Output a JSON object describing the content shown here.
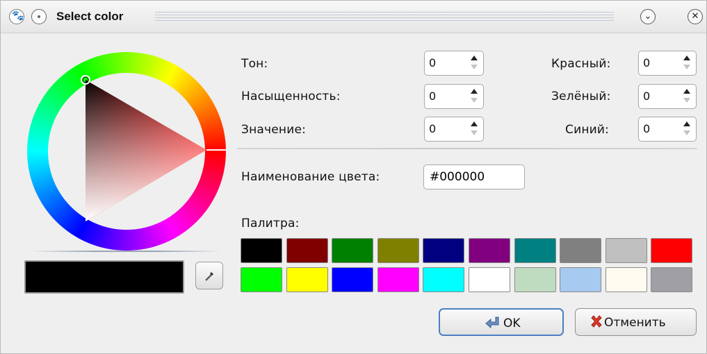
{
  "window": {
    "title": "Select color",
    "icons": [
      "paw-icon",
      "sticky-dot-icon",
      "minimize-chevron-icon",
      "close-x-icon"
    ]
  },
  "hsv": {
    "hue_label": "Тон:",
    "hue_value": "0",
    "saturation_label": "Насыщенность:",
    "saturation_value": "0",
    "value_label": "Значение:",
    "value_value": "0"
  },
  "rgb": {
    "red_label": "Красный:",
    "red_value": "0",
    "green_label": "Зелёный:",
    "green_value": "0",
    "blue_label": "Синий:",
    "blue_value": "0"
  },
  "color_name": {
    "label": "Наименование цвета:",
    "value": "#000000"
  },
  "current_color": "#000000",
  "palette": {
    "label": "Палитра:",
    "colors": [
      "#000000",
      "#800000",
      "#008000",
      "#808000",
      "#000080",
      "#800080",
      "#008080",
      "#808080",
      "#c0c0c0",
      "#ff0000",
      "#00ff00",
      "#ffff00",
      "#0000ff",
      "#ff00ff",
      "#00ffff",
      "#ffffff",
      "#c0dcc0",
      "#a6caf0",
      "#fffbf0",
      "#a0a0a4"
    ]
  },
  "buttons": {
    "ok_label": "OK",
    "cancel_label": "Отменить"
  }
}
